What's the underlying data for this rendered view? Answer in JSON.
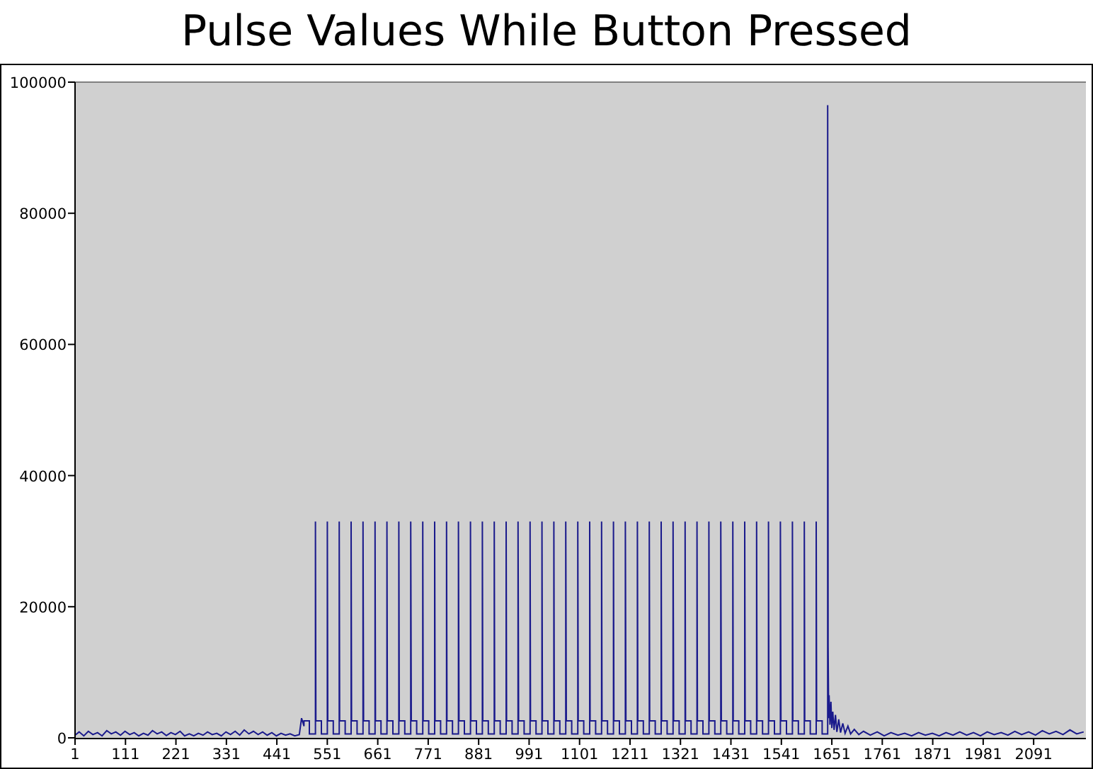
{
  "chart": {
    "chart_data": {
      "type": "line",
      "title": "Pulse Values While Button Pressed",
      "xlim": [
        1,
        2205
      ],
      "ylim": [
        0,
        100000
      ],
      "xticks": [
        1,
        111,
        221,
        331,
        441,
        551,
        661,
        771,
        881,
        991,
        1101,
        1211,
        1321,
        1431,
        1541,
        1651,
        1761,
        1871,
        1981,
        2091
      ],
      "yticks": [
        0,
        20000,
        40000,
        60000,
        80000,
        100000
      ],
      "x": [
        1,
        10,
        20,
        30,
        40,
        50,
        60,
        70,
        80,
        90,
        100,
        110,
        120,
        130,
        140,
        150,
        160,
        170,
        180,
        190,
        200,
        210,
        220,
        230,
        240,
        250,
        260,
        270,
        280,
        290,
        300,
        310,
        320,
        330,
        340,
        350,
        360,
        370,
        380,
        390,
        400,
        410,
        420,
        430,
        440,
        450,
        460,
        470,
        480,
        490,
        495,
        500,
        500,
        512,
        512,
        525,
        525,
        526,
        538,
        538,
        551,
        551,
        552,
        564,
        564,
        577,
        577,
        578,
        590,
        590,
        603,
        603,
        604,
        616,
        616,
        629,
        629,
        630,
        642,
        642,
        655,
        655,
        656,
        668,
        668,
        681,
        681,
        682,
        694,
        694,
        707,
        707,
        708,
        720,
        720,
        733,
        733,
        734,
        746,
        746,
        759,
        759,
        760,
        772,
        772,
        785,
        785,
        786,
        798,
        798,
        811,
        811,
        812,
        824,
        824,
        837,
        837,
        838,
        850,
        850,
        863,
        863,
        864,
        876,
        876,
        889,
        889,
        890,
        902,
        902,
        915,
        915,
        916,
        928,
        928,
        941,
        941,
        942,
        954,
        954,
        967,
        967,
        968,
        980,
        980,
        993,
        993,
        994,
        1006,
        1006,
        1019,
        1019,
        1020,
        1032,
        1032,
        1045,
        1045,
        1046,
        1058,
        1058,
        1071,
        1071,
        1072,
        1084,
        1084,
        1097,
        1097,
        1098,
        1110,
        1110,
        1123,
        1123,
        1124,
        1136,
        1136,
        1149,
        1149,
        1150,
        1162,
        1162,
        1175,
        1175,
        1176,
        1188,
        1188,
        1201,
        1201,
        1202,
        1214,
        1214,
        1227,
        1227,
        1228,
        1240,
        1240,
        1253,
        1253,
        1254,
        1266,
        1266,
        1279,
        1279,
        1280,
        1292,
        1292,
        1305,
        1305,
        1306,
        1318,
        1318,
        1331,
        1331,
        1332,
        1344,
        1344,
        1357,
        1357,
        1358,
        1370,
        1370,
        1383,
        1383,
        1384,
        1396,
        1396,
        1409,
        1409,
        1410,
        1422,
        1422,
        1435,
        1435,
        1436,
        1448,
        1448,
        1461,
        1461,
        1462,
        1474,
        1474,
        1487,
        1487,
        1488,
        1500,
        1500,
        1513,
        1513,
        1514,
        1526,
        1526,
        1539,
        1539,
        1540,
        1552,
        1552,
        1565,
        1565,
        1566,
        1578,
        1578,
        1591,
        1591,
        1592,
        1604,
        1604,
        1617,
        1617,
        1618,
        1630,
        1630,
        1642,
        1642,
        1643,
        1644,
        1645,
        1647,
        1649,
        1651,
        1653,
        1656,
        1659,
        1662,
        1666,
        1670,
        1675,
        1680,
        1686,
        1692,
        1700,
        1710,
        1720,
        1735,
        1750,
        1765,
        1780,
        1795,
        1810,
        1825,
        1840,
        1855,
        1870,
        1885,
        1900,
        1915,
        1930,
        1945,
        1960,
        1975,
        1990,
        2005,
        2020,
        2035,
        2050,
        2065,
        2080,
        2095,
        2110,
        2125,
        2140,
        2155,
        2170,
        2185,
        2200
      ],
      "series": [
        {
          "color": "#1a1a8c",
          "values": [
            400,
            900,
            300,
            1000,
            500,
            800,
            300,
            1100,
            600,
            900,
            400,
            1000,
            500,
            800,
            300,
            700,
            400,
            1100,
            600,
            900,
            350,
            800,
            500,
            1000,
            300,
            600,
            300,
            700,
            400,
            900,
            500,
            700,
            300,
            900,
            500,
            1000,
            400,
            1200,
            600,
            1000,
            500,
            900,
            400,
            800,
            300,
            700,
            400,
            600,
            300,
            500,
            3000,
            1800,
            2600,
            2600,
            600,
            600,
            33000,
            2600,
            2600,
            600,
            600,
            33000,
            2600,
            2600,
            600,
            600,
            33000,
            2600,
            2600,
            600,
            600,
            33000,
            2600,
            2600,
            600,
            600,
            33000,
            2600,
            2600,
            600,
            600,
            33000,
            2600,
            2600,
            600,
            600,
            33000,
            2600,
            2600,
            600,
            600,
            33000,
            2600,
            2600,
            600,
            600,
            33000,
            2600,
            2600,
            600,
            600,
            33000,
            2600,
            2600,
            600,
            600,
            33000,
            2600,
            2600,
            600,
            600,
            33000,
            2600,
            2600,
            600,
            600,
            33000,
            2600,
            2600,
            600,
            600,
            33000,
            2600,
            2600,
            600,
            600,
            33000,
            2600,
            2600,
            600,
            600,
            33000,
            2600,
            2600,
            600,
            600,
            33000,
            2600,
            2600,
            600,
            600,
            33000,
            2600,
            2600,
            600,
            600,
            33000,
            2600,
            2600,
            600,
            600,
            33000,
            2600,
            2600,
            600,
            600,
            33000,
            2600,
            2600,
            600,
            600,
            33000,
            2600,
            2600,
            600,
            600,
            33000,
            2600,
            2600,
            600,
            600,
            33000,
            2600,
            2600,
            600,
            600,
            33000,
            2600,
            2600,
            600,
            600,
            33000,
            2600,
            2600,
            600,
            600,
            33000,
            2600,
            2600,
            600,
            600,
            33000,
            2600,
            2600,
            600,
            600,
            33000,
            2600,
            2600,
            600,
            600,
            33000,
            2600,
            2600,
            600,
            600,
            33000,
            2600,
            2600,
            600,
            600,
            33000,
            2600,
            2600,
            600,
            600,
            33000,
            2600,
            2600,
            600,
            600,
            33000,
            2600,
            2600,
            600,
            600,
            33000,
            2600,
            2600,
            600,
            600,
            33000,
            2600,
            2600,
            600,
            600,
            33000,
            2600,
            2600,
            600,
            600,
            33000,
            2600,
            2600,
            600,
            600,
            33000,
            2600,
            2600,
            600,
            600,
            33000,
            2600,
            2600,
            600,
            600,
            33000,
            2600,
            2600,
            600,
            600,
            33000,
            2600,
            2600,
            600,
            600,
            33000,
            2600,
            2600,
            600,
            600,
            96500,
            14000,
            3000,
            6500,
            2000,
            5500,
            1500,
            4000,
            1200,
            3500,
            900,
            2800,
            800,
            2200,
            700,
            1800,
            600,
            1300,
            500,
            1000,
            400,
            900,
            300,
            800,
            400,
            700,
            300,
            800,
            400,
            700,
            300,
            800,
            400,
            900,
            400,
            800,
            300,
            900,
            500,
            800,
            400,
            1000,
            500,
            900,
            400,
            1100,
            600,
            1000,
            500,
            1200,
            600,
            900
          ]
        }
      ]
    }
  }
}
